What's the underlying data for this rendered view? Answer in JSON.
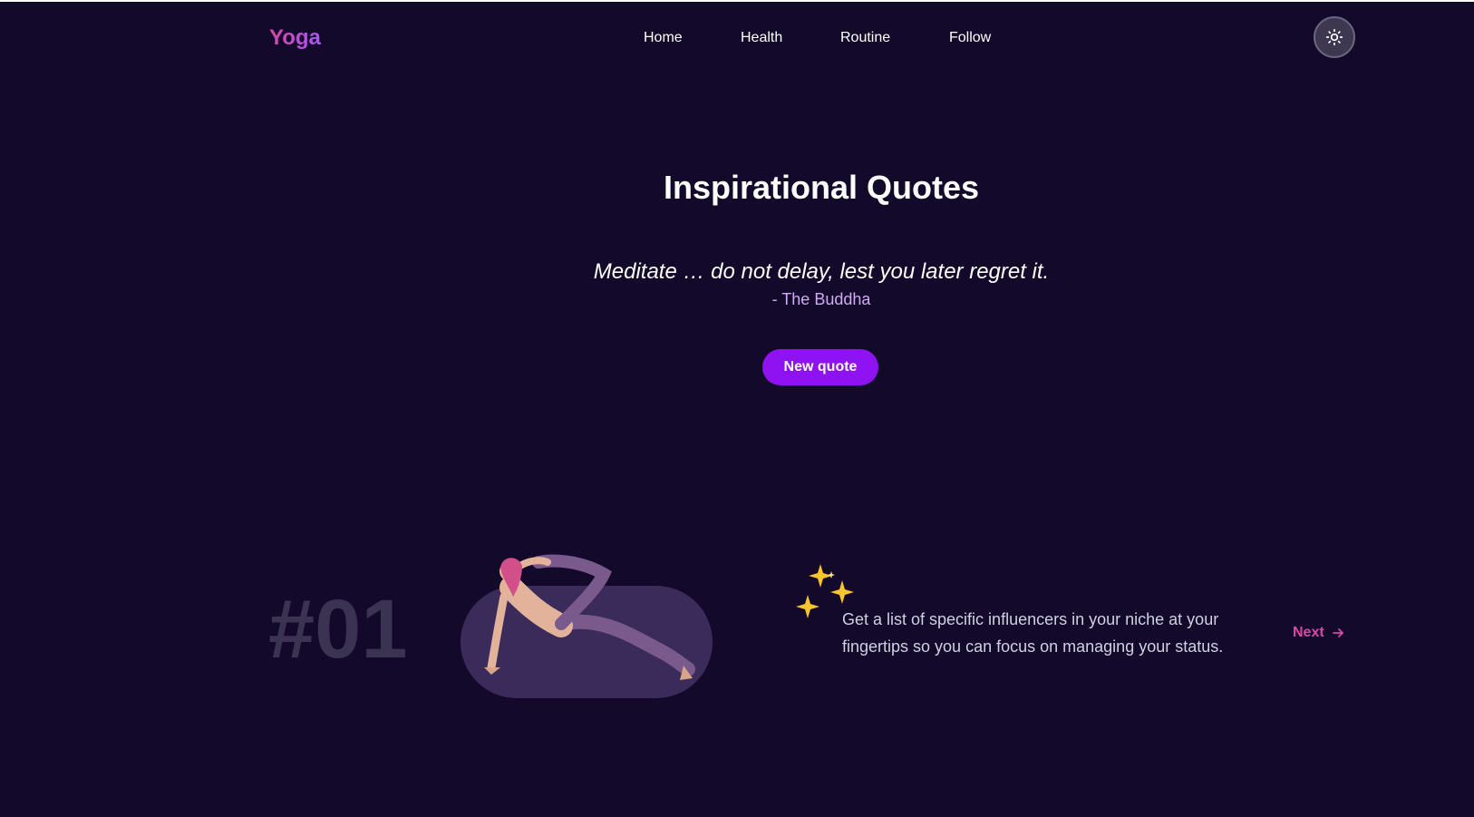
{
  "header": {
    "logo": "Yoga",
    "nav": [
      {
        "label": "Home"
      },
      {
        "label": "Health"
      },
      {
        "label": "Routine"
      },
      {
        "label": "Follow"
      }
    ],
    "theme_toggle_icon": "sun-icon"
  },
  "quote_section": {
    "title": "Inspirational Quotes",
    "quote": "Meditate … do not delay, lest you later regret it.",
    "author": "- The Buddha",
    "button_label": "New quote"
  },
  "slide": {
    "number": "#01",
    "image": "yoga-pose-image",
    "decoration_icon": "sparkles-icon",
    "text": "Get a list of specific influencers in your niche at your fingertips so you can focus on managing your status.",
    "next_label": "Next",
    "next_icon": "arrow-right-icon"
  },
  "colors": {
    "background": "#13092b",
    "accent": "#8f13f2",
    "brand_pink": "#d946a8",
    "author": "#d3aaf5"
  }
}
